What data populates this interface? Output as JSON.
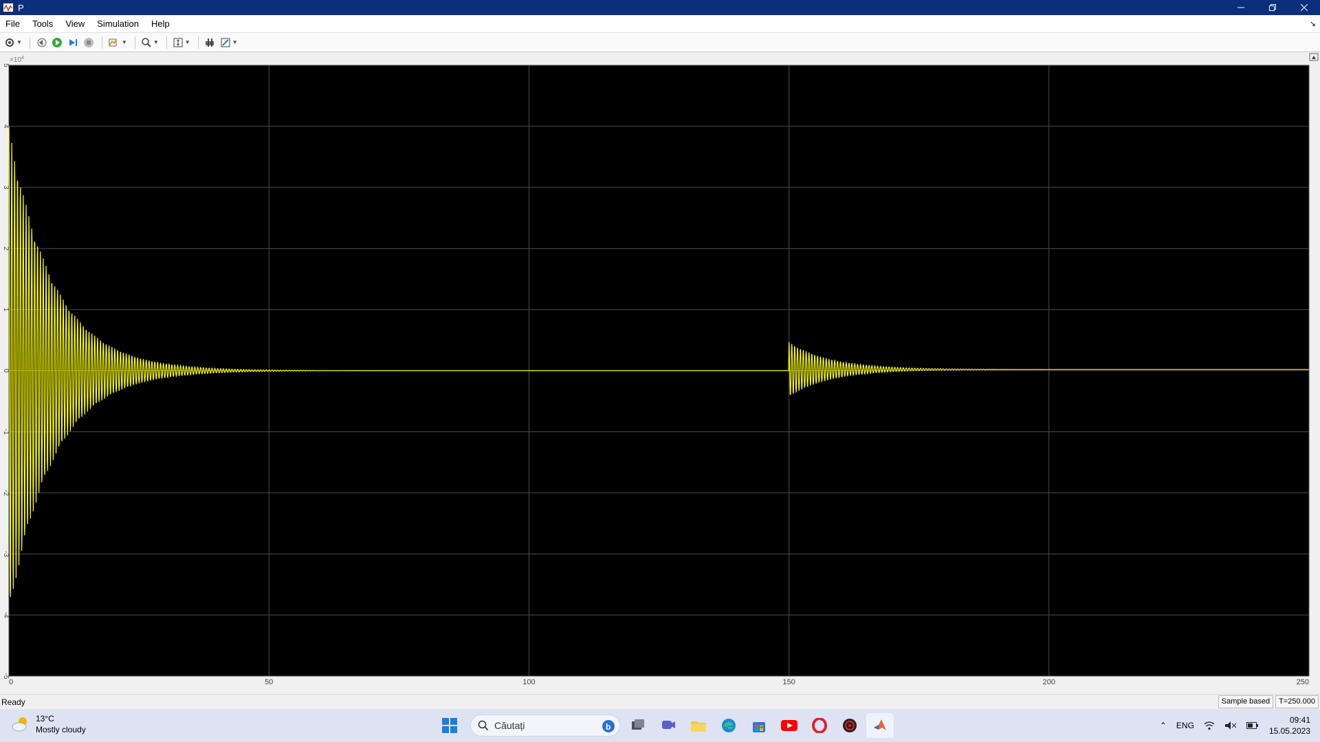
{
  "window": {
    "title": "P",
    "app_icon": "matlab-scope-icon",
    "controls": [
      "minimize-icon",
      "restore-icon",
      "close-icon"
    ]
  },
  "menubar": {
    "items": [
      "File",
      "Tools",
      "View",
      "Simulation",
      "Help"
    ]
  },
  "toolbar": {
    "buttons": [
      "settings-icon",
      "step-back-icon",
      "run-icon",
      "step-forward-icon",
      "stop-icon",
      "highlight-icon",
      "zoom-icon",
      "scale-axes-icon",
      "cursor-measure-icon",
      "style-icon"
    ]
  },
  "chart_data": {
    "type": "line",
    "title": "",
    "xlabel": "",
    "ylabel": "",
    "y_exponent_label": "x10^4",
    "xlim": [
      0,
      250
    ],
    "ylim": [
      -5,
      5
    ],
    "x_ticks": [
      "0",
      "50",
      "100",
      "150",
      "200",
      "250"
    ],
    "y_ticks": [
      "-5",
      "-4",
      "-3",
      "-2",
      "-1",
      "0",
      "1",
      "2",
      "3",
      "4",
      "5"
    ],
    "grid": true,
    "background": "#000000",
    "grid_color": "#4d4d4d",
    "series": [
      {
        "color": "#ffff00",
        "description": "damped oscillation",
        "segments": [
          {
            "start_x": 0,
            "start_amplitude": 4.0,
            "offset": 0,
            "decay_time_constant": 8.5,
            "period": 0.55
          },
          {
            "start_x": 150,
            "start_amplitude": 0.45,
            "offset": 0.02,
            "decay_time_constant": 8.0,
            "period": 0.55
          }
        ],
        "steady_value": 0.02
      }
    ]
  },
  "statusbar": {
    "left": "Ready",
    "mode": "Sample based",
    "time": "T=250.000"
  },
  "taskbar": {
    "weather_temp": "13°C",
    "weather_desc": "Mostly cloudy",
    "search_placeholder": "Căutați",
    "language": "ENG",
    "time": "09:41",
    "date": "15.05.2023"
  }
}
